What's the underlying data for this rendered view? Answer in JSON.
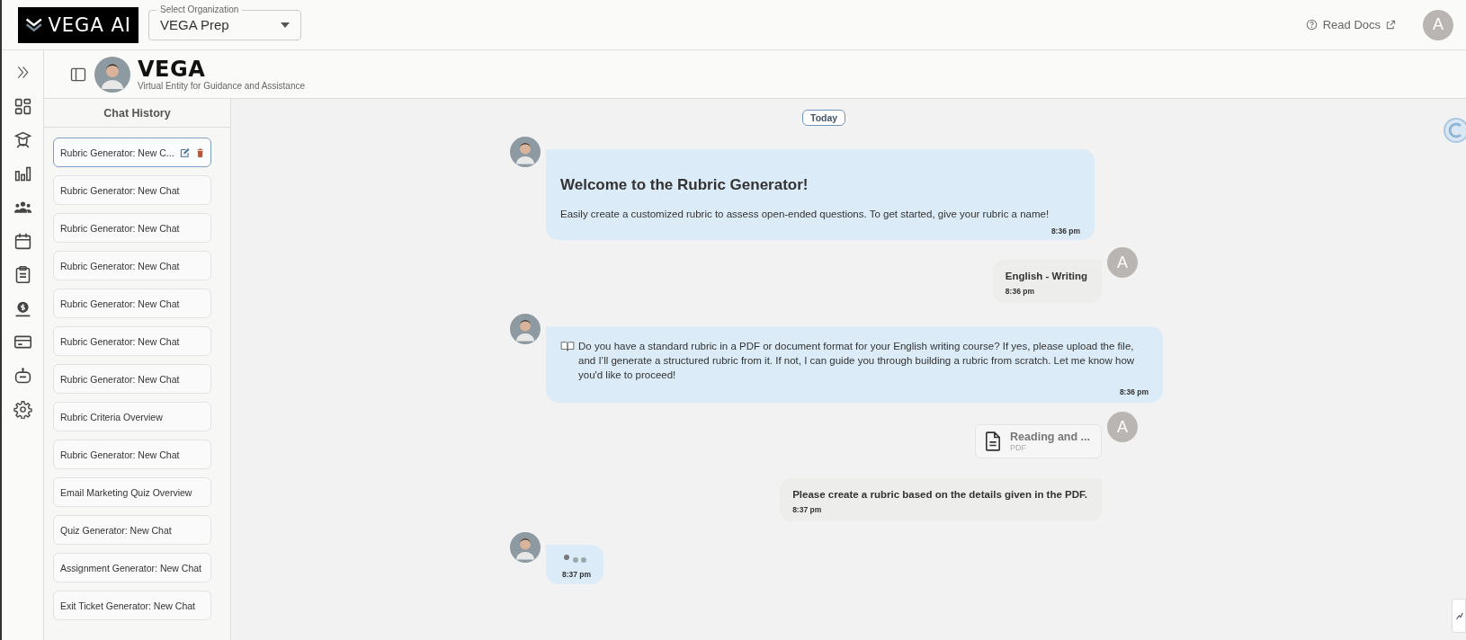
{
  "header": {
    "logo": "VEGA AI",
    "organization": {
      "label": "Select Organization",
      "value": "VEGA Prep"
    },
    "docs_link": "Read Docs",
    "user_avatar": "A"
  },
  "assistant": {
    "name": "VEGA",
    "subtitle": "Virtual Entity for Guidance and Assistance"
  },
  "chat_history": {
    "title": "Chat History",
    "items": [
      {
        "label": "Rubric Generator: New C...",
        "selected": true
      },
      {
        "label": "Rubric Generator: New Chat",
        "selected": false
      },
      {
        "label": "Rubric Generator: New Chat",
        "selected": false
      },
      {
        "label": "Rubric Generator: New Chat",
        "selected": false
      },
      {
        "label": "Rubric Generator: New Chat",
        "selected": false
      },
      {
        "label": "Rubric Generator: New Chat",
        "selected": false
      },
      {
        "label": "Rubric Generator: New Chat",
        "selected": false
      },
      {
        "label": "Rubric Criteria Overview",
        "selected": false
      },
      {
        "label": "Rubric Generator: New Chat",
        "selected": false
      },
      {
        "label": "Email Marketing Quiz Overview",
        "selected": false
      },
      {
        "label": "Quiz Generator: New Chat",
        "selected": false
      },
      {
        "label": "Assignment Generator: New Chat",
        "selected": false
      },
      {
        "label": "Exit Ticket Generator: New Chat",
        "selected": false
      }
    ]
  },
  "conversation": {
    "date_label": "Today",
    "messages": [
      {
        "kind": "bot",
        "title": "Welcome to the Rubric Generator!",
        "text": "Easily create a customized rubric to assess open-ended questions. To get started, give your rubric a name!",
        "time": "8:36 pm"
      },
      {
        "kind": "user",
        "avatar": "A",
        "text": "English - Writing",
        "time": "8:36 pm"
      },
      {
        "kind": "bot",
        "text": "Do you have a standard rubric in a PDF or document format for your English writing course? If yes, please upload the file, and I’ll generate a structured rubric from it. If not, I can guide you through building a rubric from scratch. Let me know how you'd like to proceed!",
        "time": "8:36 pm"
      },
      {
        "kind": "file",
        "avatar": "A",
        "name": "Reading and ...",
        "type": "PDF"
      },
      {
        "kind": "user",
        "text": "Please create a rubric based on the details given in the PDF.",
        "time": "8:37 pm"
      },
      {
        "kind": "typing",
        "time": "8:37 pm"
      }
    ]
  }
}
